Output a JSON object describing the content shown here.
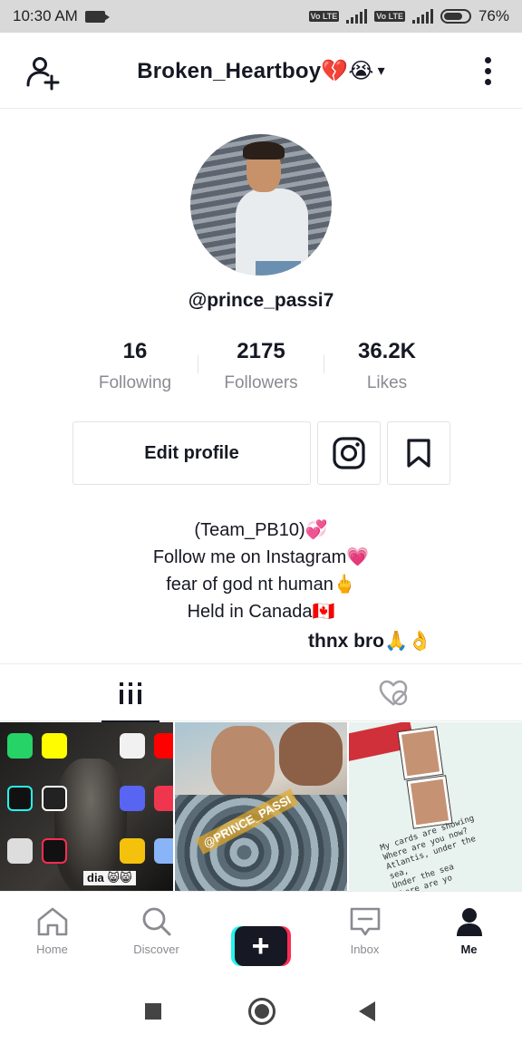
{
  "status_bar": {
    "time": "10:30 AM",
    "volte_1": "Vo LTE",
    "volte_2": "Vo LTE",
    "battery": "76%",
    "battery_level": 0.76
  },
  "header": {
    "title": "Broken_Heartboy💔😭",
    "caret": "▾"
  },
  "profile": {
    "username": "@prince_passi7"
  },
  "stats": [
    {
      "value": "16",
      "label": "Following"
    },
    {
      "value": "2175",
      "label": "Followers"
    },
    {
      "value": "36.2K",
      "label": "Likes"
    }
  ],
  "actions": {
    "edit_profile": "Edit profile"
  },
  "bio": {
    "lines": [
      "(Team_PB10)💞",
      "Follow me on Instagram💗",
      "fear of god nt human🖕",
      "Held in Canada🇨🇦"
    ],
    "overlay_comment": "thnx bro🙏👌"
  },
  "grid": {
    "thumb_1_caption": "dia 😸😸",
    "thumb_2_tag": "@PRINCE_PASSI",
    "thumb_3_note": "My cards are showing\nWhere are you now?\nAtlantis, under the\nsea,\nUnder the sea\nWhere are yo"
  },
  "bottom_nav": {
    "home": "Home",
    "discover": "Discover",
    "create": "+",
    "inbox": "Inbox",
    "me": "Me"
  },
  "colors": {
    "primary_text": "#161823",
    "secondary_text": "#8a8b91",
    "cyan": "#25f4ee",
    "pink": "#fe2c55"
  }
}
